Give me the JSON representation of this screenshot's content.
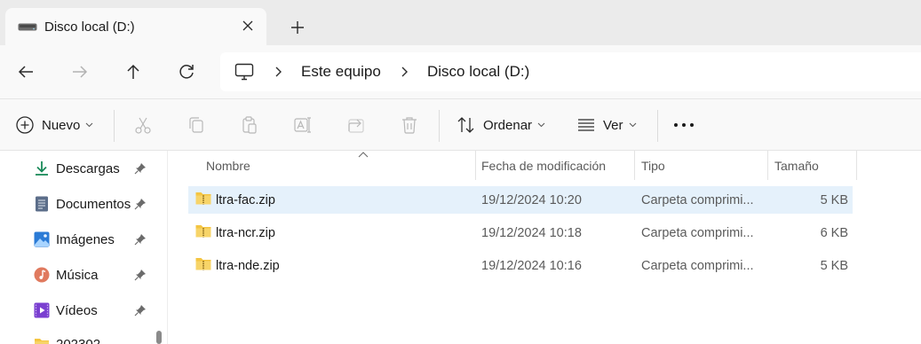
{
  "tab": {
    "title": "Disco local (D:)",
    "new_tab_glyph": "+"
  },
  "breadcrumb": {
    "items": [
      "Este equipo",
      "Disco local (D:)"
    ]
  },
  "commands": {
    "new_label": "Nuevo",
    "sort_label": "Ordenar",
    "view_label": "Ver",
    "more_glyph": "•••"
  },
  "sidebar": {
    "items": [
      {
        "label": "Descargas",
        "icon": "download-icon",
        "pinned": true
      },
      {
        "label": "Documentos",
        "icon": "document-icon",
        "pinned": true
      },
      {
        "label": "Imágenes",
        "icon": "pictures-icon",
        "pinned": true
      },
      {
        "label": "Música",
        "icon": "music-icon",
        "pinned": true
      },
      {
        "label": "Vídeos",
        "icon": "videos-icon",
        "pinned": true
      },
      {
        "label": "202302",
        "icon": "folder-icon",
        "pinned": false
      }
    ]
  },
  "columns": {
    "name": "Nombre",
    "date": "Fecha de modificación",
    "type": "Tipo",
    "size": "Tamaño"
  },
  "files": [
    {
      "name": "ltra-fac.zip",
      "date": "19/12/2024 10:20",
      "type": "Carpeta comprimi...",
      "size": "5 KB",
      "selected": true
    },
    {
      "name": "ltra-ncr.zip",
      "date": "19/12/2024 10:18",
      "type": "Carpeta comprimi...",
      "size": "6 KB",
      "selected": false
    },
    {
      "name": "ltra-nde.zip",
      "date": "19/12/2024 10:16",
      "type": "Carpeta comprimi...",
      "size": "5 KB",
      "selected": false
    }
  ],
  "colors": {
    "selection": "#e5f1fb",
    "accent": "#0067c0",
    "folder": "#f4c542"
  }
}
